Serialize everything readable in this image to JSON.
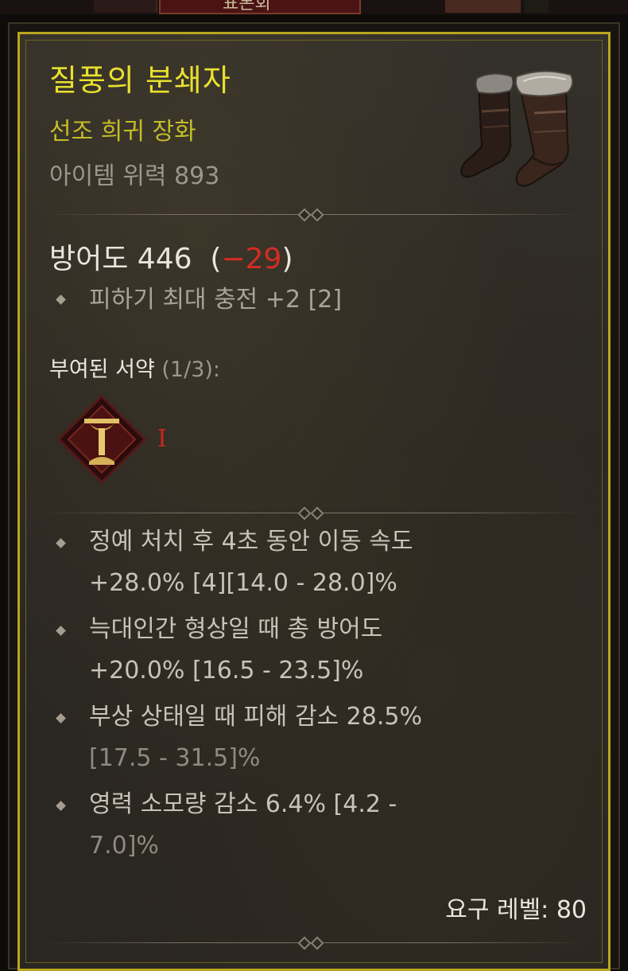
{
  "top_bar": {
    "tab_label": "표본회"
  },
  "item": {
    "name": "질풍의 분쇄자",
    "rarity_type": "선조 희귀 장화",
    "item_power": "아이템 위력 893",
    "icon": "boots-icon",
    "armor_label": "방어도 446",
    "armor_delta_open": "(",
    "armor_delta": "−29",
    "armor_delta_close": ")",
    "implicit": "피하기 최대 충전 +2 [2]",
    "glyph_header": "부여된 서약",
    "glyph_count": "(1/3):",
    "glyph_level": "I",
    "affixes": [
      {
        "line1": "정예 처치 후 4초 동안 이동 속도",
        "line2": "+28.0% [4][14.0 - 28.0]%"
      },
      {
        "line1": "늑대인간 형상일 때 총 방어도",
        "line2": "+20.0% [16.5 - 23.5]%"
      },
      {
        "line1": "부상 상태일 때 피해 감소 28.5%",
        "line2": "[17.5 - 31.5]%"
      },
      {
        "line1": "영력 소모량 감소 6.4% [4.2 -",
        "line2": "7.0]%"
      }
    ],
    "required_level": "요구 레벨: 80"
  },
  "colors": {
    "legendary_name": "#e8e12f",
    "rarity": "#c4bd28",
    "negative": "#d42d22",
    "border": "#b9a61e"
  }
}
